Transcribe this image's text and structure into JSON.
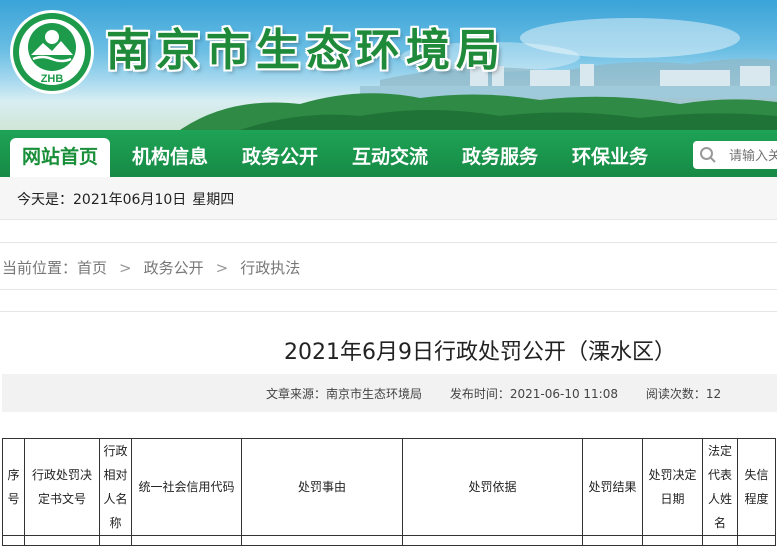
{
  "header": {
    "logo_text": "ZHB",
    "site_title": "南京市生态环境局"
  },
  "nav": {
    "items": [
      {
        "label": "网站首页",
        "active": true
      },
      {
        "label": "机构信息",
        "active": false
      },
      {
        "label": "政务公开",
        "active": false
      },
      {
        "label": "互动交流",
        "active": false
      },
      {
        "label": "政务服务",
        "active": false
      },
      {
        "label": "环保业务",
        "active": false
      }
    ],
    "search_placeholder": "请输入关"
  },
  "datebar": {
    "label": "今天是：",
    "date": "2021年06月10日",
    "weekday": "星期四"
  },
  "breadcrumb": {
    "prefix": "当前位置：",
    "items": [
      "首页",
      "政务公开",
      "行政执法"
    ]
  },
  "article": {
    "title": "2021年6月9日行政处罚公开（溧水区）",
    "source": "文章来源：南京市生态环境局",
    "publish_time": "发布时间：2021-06-10 11:08",
    "read_count": "阅读次数：12"
  },
  "table": {
    "headers": [
      "序号",
      "行政处罚决定书文号",
      "行政相对人名称",
      "统一社会信用代码",
      "处罚事由",
      "处罚依据",
      "处罚结果",
      "处罚决定日期",
      "法定代表人姓名",
      "失信程度"
    ]
  },
  "colors": {
    "nav_green": "#178a45",
    "title_green": "#1f8a3a",
    "banner_sky": "#3aa3d8"
  }
}
